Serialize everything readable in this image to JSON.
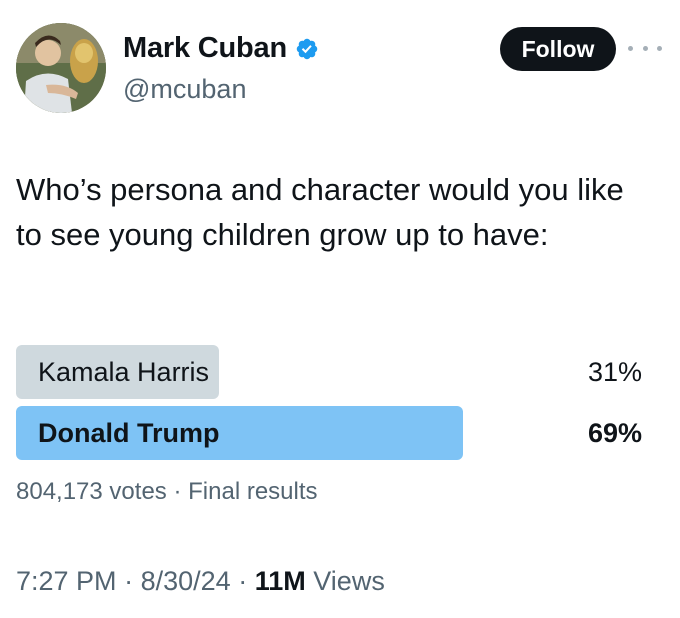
{
  "author": {
    "display_name": "Mark Cuban",
    "handle": "@mcuban",
    "verified_icon": "verified-badge-icon",
    "verified_color": "#1d9bf0"
  },
  "actions": {
    "follow_label": "Follow",
    "more_icon": "more-horizontal-icon"
  },
  "tweet": {
    "text": "Who’s persona and character would you like to see young children grow up to have:"
  },
  "poll": {
    "options": [
      {
        "label": "Kamala Harris",
        "percent_label": "31%",
        "percent": 31,
        "winner": false,
        "bar_color": "#cfd9de"
      },
      {
        "label": "Donald Trump",
        "percent_label": "69%",
        "percent": 69,
        "winner": true,
        "bar_color": "#7ec3f5"
      }
    ],
    "votes": "804,173 votes",
    "separator": "·",
    "status": "Final results"
  },
  "footer": {
    "time": "7:27 PM",
    "date": "8/30/24",
    "separator": "·",
    "views_count": "11M",
    "views_label": "Views"
  },
  "colors": {
    "text_primary": "#0f1419",
    "text_secondary": "#536471",
    "follow_bg": "#0f1419"
  }
}
